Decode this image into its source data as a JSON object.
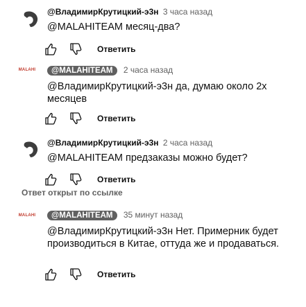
{
  "comments": [
    {
      "author": "@ВладимирКрутицкий-э3н",
      "time": "3 часа назад",
      "text": "@MALAHITEAM месяц-два?",
      "reply_label": "Ответить"
    },
    {
      "author_badge": "@MALAHITEAM",
      "time": "2 часа назад",
      "text": "@ВладимирКрутицкий-э3н  да, думаю около 2х месяцев",
      "reply_label": "Ответить",
      "channel_logo": "MALAHI"
    },
    {
      "author": "@ВладимирКрутицкий-э3н",
      "time": "2 часа назад",
      "text": "@MALAHITEAM предзаказы можно будет?",
      "reply_label": "Ответить"
    },
    {
      "author_badge": "@MALAHITEAM",
      "time": "35 минут назад",
      "text": "@ВладимирКрутицкий-э3н  Нет. Примерник будет производиться в Китае, оттуда же и продаваться.",
      "reply_label": "Ответить",
      "channel_logo": "MALAHI"
    }
  ],
  "replied_to_note": "Ответ открыт по ссылке",
  "icons": {
    "like": "thumb-up-icon",
    "dislike": "thumb-down-icon",
    "avatar": "user-avatar-icon"
  },
  "colors": {
    "badge_bg": "#606060",
    "secondary_text": "#606060",
    "avatar": "#3d3d3d"
  }
}
